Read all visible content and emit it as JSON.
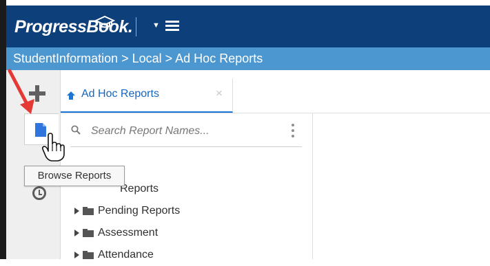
{
  "app": {
    "logo_text": "ProgressBook.",
    "menu_caret_icon": "caret-down-icon",
    "menu_icon": "hamburger-menu-icon"
  },
  "breadcrumb": {
    "text": "StudentInformation > Local > Ad Hoc Reports"
  },
  "tabs": [
    {
      "label": "Ad Hoc Reports",
      "icon": "home-icon",
      "close_icon": "close-icon"
    }
  ],
  "search": {
    "placeholder": "Search Report Names...",
    "value": "",
    "icon": "search-icon",
    "options_icon": "more-vertical-icon"
  },
  "tooltip": {
    "text": "Browse Reports"
  },
  "tree": {
    "items": [
      {
        "label": "Reports",
        "visible_suffix": true
      },
      {
        "label": "Pending Reports"
      },
      {
        "label": "Assessment"
      },
      {
        "label": "Attendance"
      }
    ]
  },
  "colors": {
    "top_bar": "#0d3f7a",
    "breadcrumb_bar": "#4d97d1",
    "accent": "#1976d2",
    "annotation_arrow": "#e53935"
  }
}
